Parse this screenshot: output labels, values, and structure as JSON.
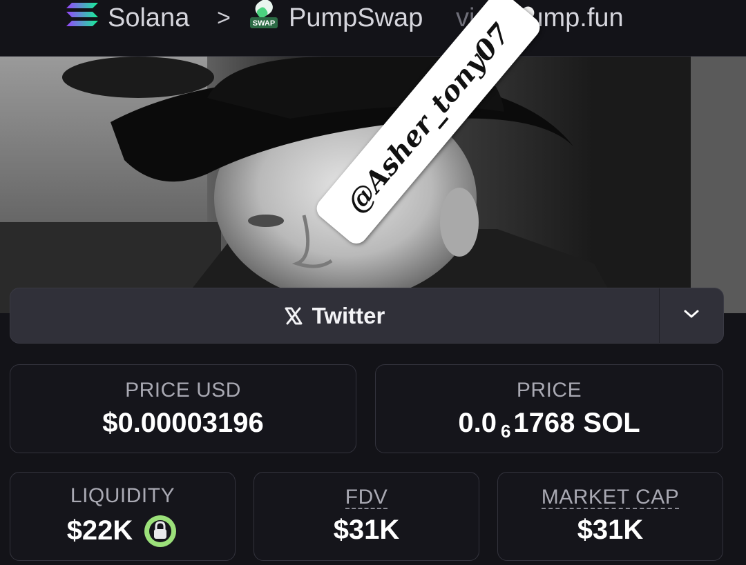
{
  "breadcrumb": {
    "chain": "Solana",
    "separator": ">",
    "dex": "PumpSwap",
    "dex_badge": "SWAP",
    "via": "via",
    "launchpad": "Pump.fun"
  },
  "watermark": "@Asher_tony07",
  "social": {
    "twitter_label": "Twitter",
    "icon": "x-logo-icon",
    "dropdown_icon": "chevron-down-icon"
  },
  "stats": {
    "price_usd": {
      "label": "PRICE USD",
      "value": "$0.00003196"
    },
    "price": {
      "label": "PRICE",
      "prefix": "0.0",
      "zeros": "6",
      "digits": "1768",
      "unit": "SOL"
    },
    "liquidity": {
      "label": "LIQUIDITY",
      "value": "$22K",
      "icon": "lock-icon"
    },
    "fdv": {
      "label": "FDV",
      "value": "$31K"
    },
    "market_cap": {
      "label": "MARKET CAP",
      "value": "$31K"
    }
  },
  "colors": {
    "background": "#131318",
    "card_border": "#33333d",
    "lock_green": "#9be07a",
    "solana_gradient": [
      "#9945FF",
      "#14F195"
    ]
  }
}
